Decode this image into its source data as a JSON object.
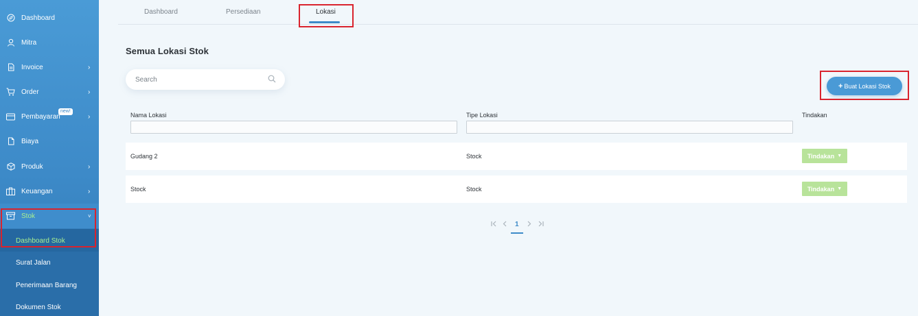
{
  "sidebar": {
    "items": [
      {
        "label": "Dashboard",
        "icon": "compass-icon",
        "has_chevron": false
      },
      {
        "label": "Mitra",
        "icon": "user-icon",
        "has_chevron": false
      },
      {
        "label": "Invoice",
        "icon": "document-icon",
        "has_chevron": true
      },
      {
        "label": "Order",
        "icon": "cart-icon",
        "has_chevron": true
      },
      {
        "label": "Pembayaran",
        "icon": "card-icon",
        "has_chevron": true,
        "badge": "new!"
      },
      {
        "label": "Biaya",
        "icon": "file-icon",
        "has_chevron": false
      },
      {
        "label": "Produk",
        "icon": "box-icon",
        "has_chevron": true
      },
      {
        "label": "Keuangan",
        "icon": "briefcase-icon",
        "has_chevron": true
      },
      {
        "label": "Stok",
        "icon": "archive-icon",
        "has_chevron": true,
        "expanded": true
      }
    ],
    "submenu": [
      "Dashboard Stok",
      "Surat Jalan",
      "Penerimaan Barang",
      "Dokumen Stok"
    ],
    "active_submenu": "Dashboard Stok"
  },
  "tabs": [
    "Dashboard",
    "Persediaan",
    "Lokasi"
  ],
  "active_tab": "Lokasi",
  "page_title": "Semua Lokasi Stok",
  "search": {
    "placeholder": "Search",
    "value": ""
  },
  "create_button": {
    "label": "Buat Lokasi Stok"
  },
  "table": {
    "columns": [
      "Nama Lokasi",
      "Tipe Lokasi",
      "Tindakan"
    ],
    "rows": [
      {
        "nama": "Gudang 2",
        "tipe": "Stock",
        "action": "Tindakan"
      },
      {
        "nama": "Stock",
        "tipe": "Stock",
        "action": "Tindakan"
      }
    ]
  },
  "pagination": {
    "current_page": "1"
  },
  "colors": {
    "sidebar": "#3d8ac8",
    "accent": "#4a9ad6",
    "active_text": "#a9f08f",
    "action_button": "#b8e39a",
    "highlight": "#d9232d"
  }
}
